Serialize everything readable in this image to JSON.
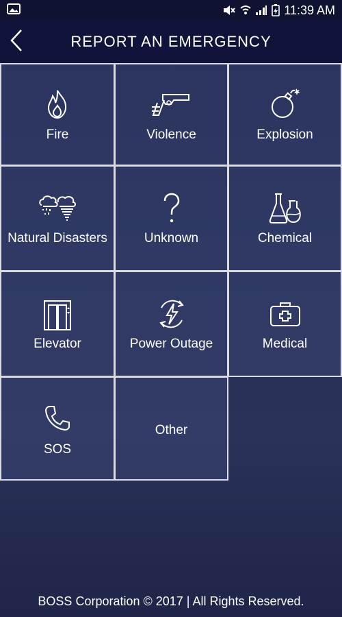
{
  "status_bar": {
    "time": "11:39 AM",
    "icons": [
      "image-icon",
      "mute-icon",
      "wifi-icon",
      "signal-icon",
      "battery-icon"
    ]
  },
  "header": {
    "title": "REPORT AN EMERGENCY",
    "back_icon": "back-chevron-icon"
  },
  "tiles": [
    {
      "label": "Fire",
      "icon": "fire-icon"
    },
    {
      "label": "Violence",
      "icon": "gun-icon"
    },
    {
      "label": "Explosion",
      "icon": "bomb-icon"
    },
    {
      "label": "Natural Disasters",
      "icon": "storm-icon"
    },
    {
      "label": "Unknown",
      "icon": "question-icon"
    },
    {
      "label": "Chemical",
      "icon": "flask-icon"
    },
    {
      "label": "Elevator",
      "icon": "elevator-icon"
    },
    {
      "label": "Power Outage",
      "icon": "power-icon"
    },
    {
      "label": "Medical",
      "icon": "medkit-icon"
    },
    {
      "label": "SOS",
      "icon": "phone-icon"
    },
    {
      "label": "Other",
      "icon": ""
    }
  ],
  "footer": {
    "text": "BOSS Corporation © 2017 | All Rights Reserved."
  },
  "colors": {
    "header_bg": "#11143a",
    "status_bg": "#0f1230",
    "tile_border": "#d9dbe6"
  }
}
